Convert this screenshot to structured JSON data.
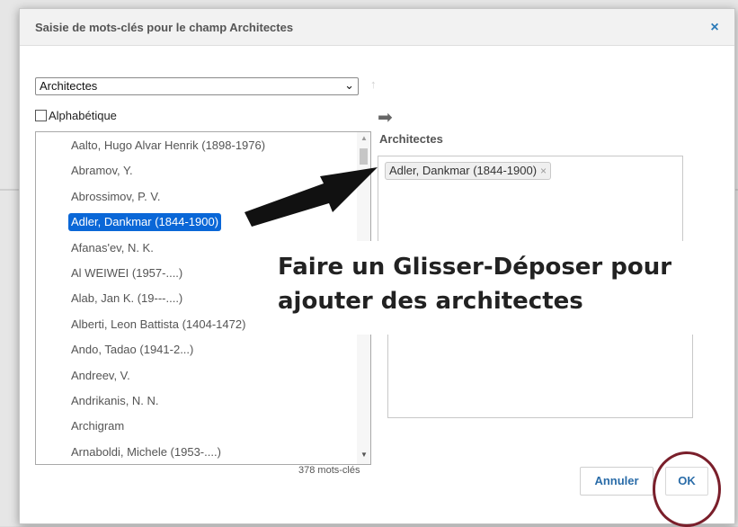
{
  "dialog": {
    "title": "Saisie de mots-clés pour le champ Architectes",
    "close_glyph": "×"
  },
  "left": {
    "select_value": "Architectes",
    "select_arrow": "⌄",
    "up_arrow": "↑",
    "alpha_label": "Alphabétique",
    "items": [
      "Aalto, Hugo Alvar Henrik (1898-1976)",
      "Abramov, Y.",
      "Abrossimov, P. V.",
      "Adler, Dankmar (1844-1900)",
      "Afanas'ev, N. K.",
      "Al WEIWEI (1957-....)",
      "Alab, Jan K. (19---....)",
      "Alberti, Leon Battista (1404-1472)",
      "Ando, Tadao (1941-2...)",
      "Andreev, V.",
      "Andrikanis, N. N.",
      "Archigram",
      "Arnaboldi, Michele (1953-....)"
    ],
    "selected_index": 3,
    "count": "378 mots-clés"
  },
  "right": {
    "transfer_arrow": "➡",
    "section_title": "Architectes",
    "tag_label": "Adler, Dankmar (1844-1900)",
    "tag_remove": "×",
    "partial_label": "))"
  },
  "callout": {
    "line1": "Faire un Glisser-Déposer pour",
    "line2": "ajouter des architectes"
  },
  "buttons": {
    "cancel": "Annuler",
    "ok": "OK"
  },
  "colors": {
    "selection": "#0a67d7",
    "button_text": "#2a6ca8",
    "highlight_circle": "#7a1f2b"
  }
}
